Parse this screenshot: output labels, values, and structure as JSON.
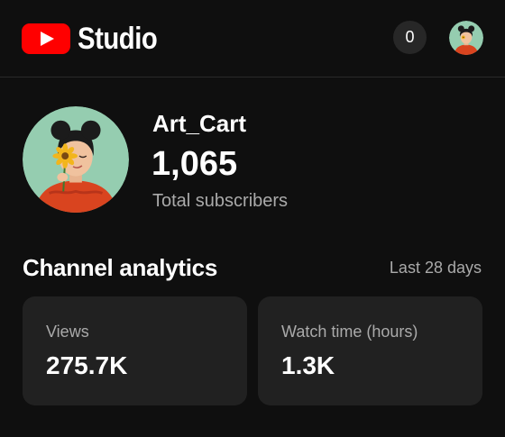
{
  "header": {
    "app_name": "Studio",
    "notification_count": "0",
    "logo_color": "#ff0000"
  },
  "channel": {
    "name": "Art_Cart",
    "subscriber_count": "1,065",
    "subscriber_label": "Total subscribers"
  },
  "analytics": {
    "title": "Channel analytics",
    "period": "Last 28 days",
    "cards": [
      {
        "label": "Views",
        "value": "275.7K"
      },
      {
        "label": "Watch time (hours)",
        "value": "1.3K"
      }
    ]
  },
  "icons": {
    "logo": "youtube-play-icon",
    "avatar": "illustrated-girl-with-sunflower"
  }
}
